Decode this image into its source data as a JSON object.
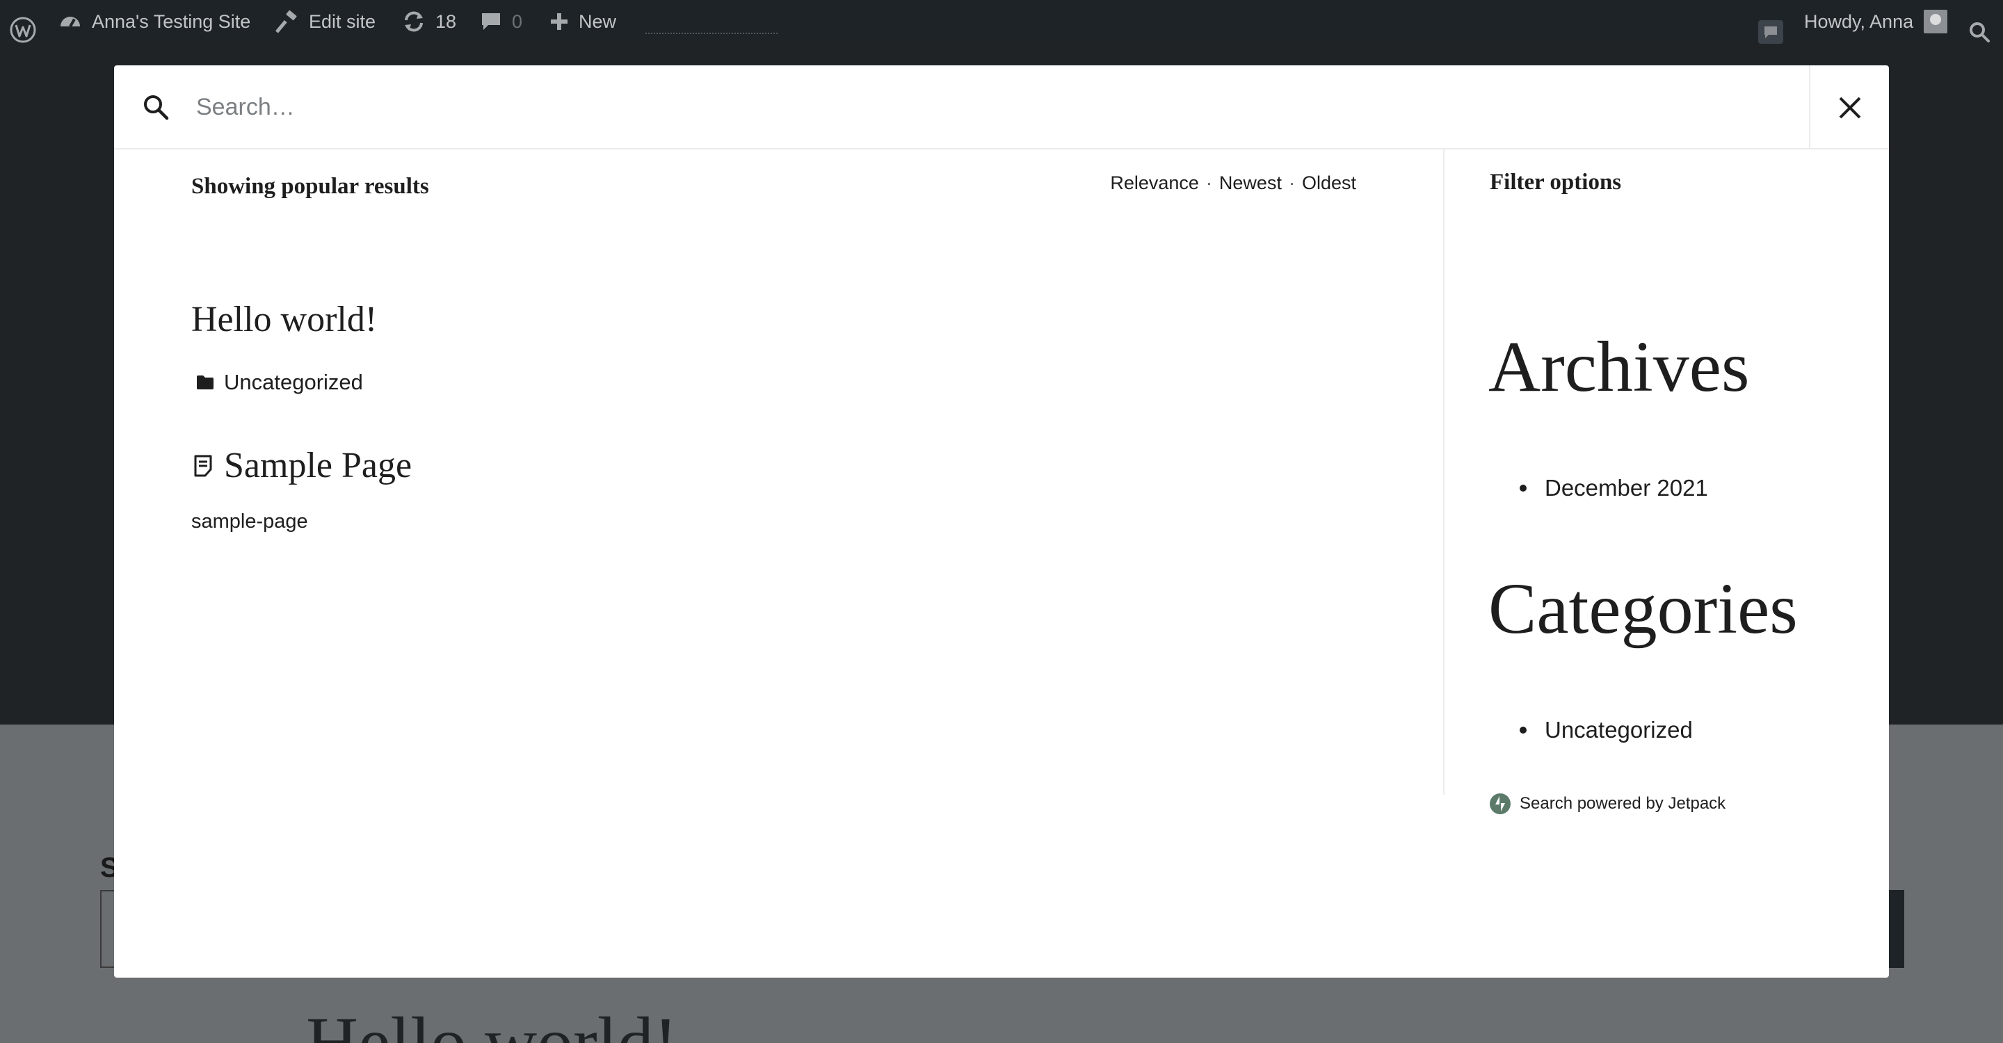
{
  "admin_bar": {
    "site_name": "Anna's Testing Site",
    "edit_site": "Edit site",
    "updates_count": "18",
    "comments_count": "0",
    "new_label": "New",
    "howdy": "Howdy, Anna"
  },
  "background": {
    "partial_label": "S",
    "heading": "Hello world!"
  },
  "search": {
    "placeholder": "Search…",
    "value": ""
  },
  "results": {
    "heading": "Showing popular results",
    "sort": [
      "Relevance",
      "Newest",
      "Oldest"
    ],
    "items": [
      {
        "title": "Hello world!",
        "category": "Uncategorized"
      },
      {
        "title": "Sample Page",
        "slug": "sample-page"
      }
    ]
  },
  "filters": {
    "heading": "Filter options",
    "archives_title": "Archives",
    "archives": [
      "December 2021"
    ],
    "categories_title": "Categories",
    "categories": [
      "Uncategorized"
    ],
    "powered_by": "Search powered by Jetpack"
  },
  "colors": {
    "admin_bar_bg": "#1d2327",
    "overlay_dark": "#1f2325",
    "overlay_gray": "#6a6e71",
    "jetpack_green": "#5b7a6a"
  }
}
